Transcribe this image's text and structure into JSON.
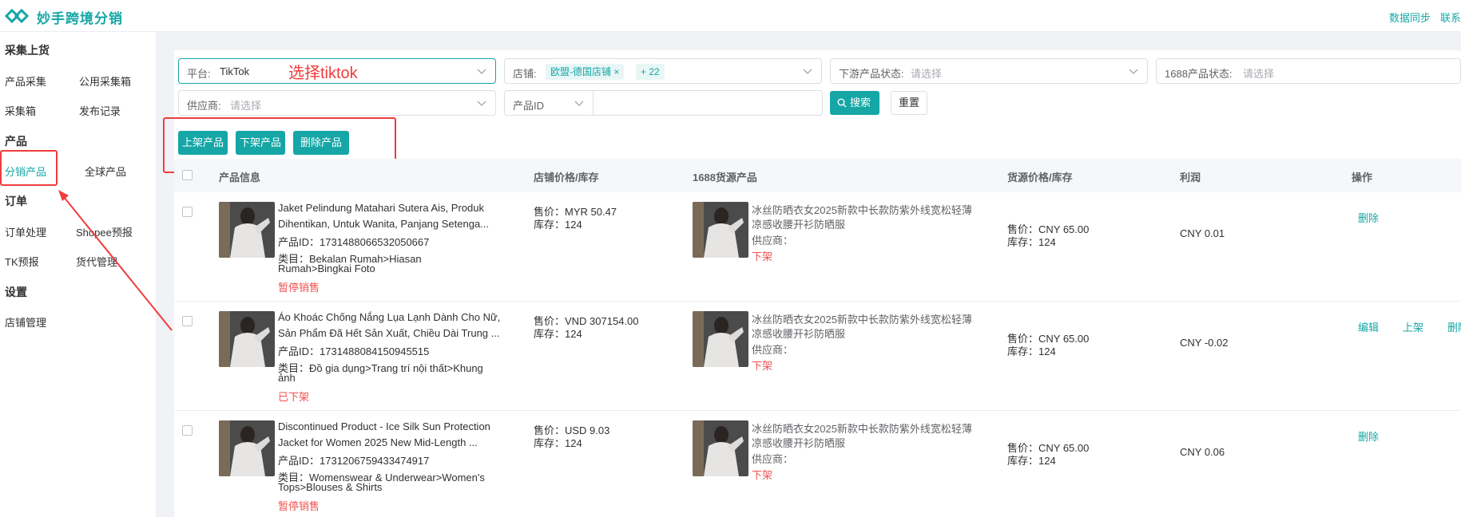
{
  "app": {
    "brand": "妙手跨境分销",
    "top_links": [
      "数据同步",
      "联系"
    ]
  },
  "sidebar": {
    "sections": [
      {
        "title": "采集上货",
        "items": [
          "产品采集",
          "公用采集箱",
          "采集箱",
          "发布记录"
        ]
      },
      {
        "title": "产品",
        "items": [
          "分销产品",
          "全球产品"
        ]
      },
      {
        "title": "订单",
        "items": [
          "订单处理",
          "Shopee预报",
          "TK预报",
          "货代管理"
        ]
      },
      {
        "title": "设置",
        "items": [
          "店铺管理"
        ]
      }
    ],
    "active_item": "分销产品"
  },
  "filters": {
    "platform": {
      "label": "平台:",
      "value": "TikTok"
    },
    "store": {
      "label": "店铺:",
      "tag": "欧盟-德国店铺",
      "more": "+ 22"
    },
    "downstream_status": {
      "label": "下游产品状态:",
      "placeholder": "请选择"
    },
    "status_1688": {
      "label": "1688产品状态:",
      "placeholder": "请选择"
    },
    "supplier": {
      "label": "供应商:",
      "placeholder": "请选择"
    },
    "product_id": {
      "label": "产品ID",
      "value": ""
    },
    "search_button": "搜索",
    "reset_button": "重置"
  },
  "annotation": "选择tiktok",
  "actions": [
    "上架产品",
    "下架产品",
    "删除产品"
  ],
  "table": {
    "headers": [
      "产品信息",
      "店铺价格/库存",
      "1688货源产品",
      "货源价格/库存",
      "利润",
      "操作"
    ],
    "rows": [
      {
        "title_line1": "Jaket Pelindung Matahari Sutera Ais, Produk",
        "title_line2": "Dihentikan, Untuk Wanita, Panjang Setenga...",
        "product_id": "产品ID：1731488066532050667",
        "category_line1": "类目：Bekalan Rumah>Hiasan",
        "category_line2": "Rumah>Bingkai Foto",
        "status": "暂停销售",
        "store_price": "售价：MYR 50.47",
        "store_stock": "库存：124",
        "source_title_line1": "冰丝防晒衣女2025新款中长款防紫外线宽松轻薄",
        "source_title_line2": "凉感收腰开衫防晒服",
        "supplier": "供应商：",
        "source_status": "下架",
        "source_price": "售价：CNY 65.00",
        "source_stock": "库存：124",
        "profit": "CNY 0.01",
        "ops": [
          "删除"
        ]
      },
      {
        "title_line1": "Áo Khoác Chống Nắng Lụa Lạnh Dành Cho Nữ,",
        "title_line2": "Sản Phẩm Đã Hết Sản Xuất, Chiều Dài Trung ...",
        "product_id": "产品ID：1731488084150945515",
        "category_line1": "类目：Đồ gia dụng>Trang trí nội thất>Khung",
        "category_line2": "ảnh",
        "status": "已下架",
        "store_price": "售价：VND 307154.00",
        "store_stock": "库存：124",
        "source_title_line1": "冰丝防晒衣女2025新款中长款防紫外线宽松轻薄",
        "source_title_line2": "凉感收腰开衫防晒服",
        "supplier": "供应商：",
        "source_status": "下架",
        "source_price": "售价：CNY 65.00",
        "source_stock": "库存：124",
        "profit": "CNY -0.02",
        "ops": [
          "编辑",
          "上架",
          "删除"
        ]
      },
      {
        "title_line1": "Discontinued Product - Ice Silk Sun Protection",
        "title_line2": "Jacket for Women 2025 New Mid-Length ...",
        "product_id": "产品ID：1731206759433474917",
        "category_line1": "类目：Womenswear & Underwear>Women's",
        "category_line2": "Tops>Blouses & Shirts",
        "status": "暂停销售",
        "store_price": "售价：USD 9.03",
        "store_stock": "库存：124",
        "source_title_line1": "冰丝防晒衣女2025新款中长款防紫外线宽松轻薄",
        "source_title_line2": "凉感收腰开衫防晒服",
        "supplier": "供应商：",
        "source_status": "下架",
        "source_price": "售价：CNY 65.00",
        "source_stock": "库存：124",
        "profit": "CNY 0.06",
        "ops": [
          "删除"
        ]
      }
    ]
  }
}
